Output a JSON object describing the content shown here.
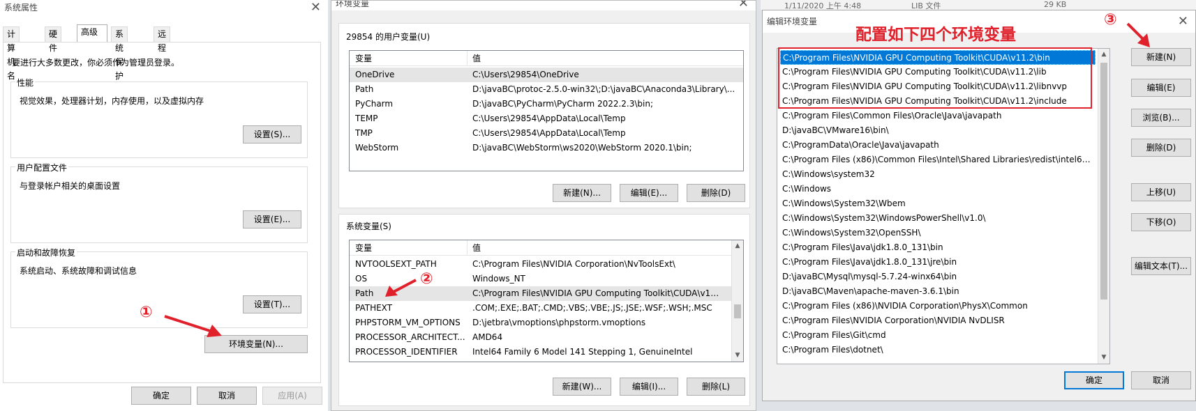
{
  "sys_props": {
    "title": "系统属性",
    "tabs": [
      "计算机名",
      "硬件",
      "高级",
      "系统保护",
      "远程"
    ],
    "admin_note": "要进行大多数更改，你必须作为管理员登录。",
    "performance": {
      "title": "性能",
      "desc": "视觉效果，处理器计划，内存使用，以及虚拟内存",
      "button": "设置(S)..."
    },
    "user_profile": {
      "title": "用户配置文件",
      "desc": "与登录帐户相关的桌面设置",
      "button": "设置(E)..."
    },
    "startup": {
      "title": "启动和故障恢复",
      "desc": "系统启动、系统故障和调试信息",
      "button": "设置(T)..."
    },
    "env_button": "环境变量(N)...",
    "ok": "确定",
    "cancel": "取消",
    "apply": "应用(A)"
  },
  "env_vars": {
    "title": "环境变量",
    "user_section": "29854 的用户变量(U)",
    "col_var": "变量",
    "col_val": "值",
    "user_rows": [
      {
        "name": "OneDrive",
        "value": "C:\\Users\\29854\\OneDrive"
      },
      {
        "name": "Path",
        "value": "D:\\javaBC\\protoc-2.5.0-win32\\;D:\\javaBC\\Anaconda3\\Library\\..."
      },
      {
        "name": "PyCharm",
        "value": "D:\\javaBC\\PyCharm\\PyCharm 2022.2.3\\bin;"
      },
      {
        "name": "TEMP",
        "value": "C:\\Users\\29854\\AppData\\Local\\Temp"
      },
      {
        "name": "TMP",
        "value": "C:\\Users\\29854\\AppData\\Local\\Temp"
      },
      {
        "name": "WebStorm",
        "value": "D:\\javaBC\\WebStorm\\ws2020\\WebStorm 2020.1\\bin;"
      }
    ],
    "user_buttons": [
      "新建(N)...",
      "编辑(E)...",
      "删除(D)"
    ],
    "sys_section": "系统变量(S)",
    "sys_rows": [
      {
        "name": "NVTOOLSEXT_PATH",
        "value": "C:\\Program Files\\NVIDIA Corporation\\NvToolsExt\\"
      },
      {
        "name": "OS",
        "value": "Windows_NT"
      },
      {
        "name": "Path",
        "value": "C:\\Program Files\\NVIDIA GPU Computing Toolkit\\CUDA\\v11...."
      },
      {
        "name": "PATHEXT",
        "value": ".COM;.EXE;.BAT;.CMD;.VBS;.VBE;.JS;.JSE;.WSF;.WSH;.MSC"
      },
      {
        "name": "PHPSTORM_VM_OPTIONS",
        "value": "D:\\jetbra\\vmoptions\\phpstorm.vmoptions"
      },
      {
        "name": "PROCESSOR_ARCHITECT...",
        "value": "AMD64"
      },
      {
        "name": "PROCESSOR_IDENTIFIER",
        "value": "Intel64 Family 6 Model 141 Stepping 1, GenuineIntel"
      }
    ],
    "sys_buttons": [
      "新建(W)...",
      "编辑(I)...",
      "删除(L)"
    ]
  },
  "edit_env": {
    "title": "编辑环境变量",
    "banner": "配置如下四个环境变量",
    "items": [
      "C:\\Program Files\\NVIDIA GPU Computing Toolkit\\CUDA\\v11.2\\bin",
      "C:\\Program Files\\NVIDIA GPU Computing Toolkit\\CUDA\\v11.2\\lib",
      "C:\\Program Files\\NVIDIA GPU Computing Toolkit\\CUDA\\v11.2\\libnvvp",
      "C:\\Program Files\\NVIDIA GPU Computing Toolkit\\CUDA\\v11.2\\include",
      "C:\\Program Files\\Common Files\\Oracle\\Java\\javapath",
      "D:\\javaBC\\VMware16\\bin\\",
      "C:\\ProgramData\\Oracle\\Java\\javapath",
      "C:\\Program Files (x86)\\Common Files\\Intel\\Shared Libraries\\redist\\intel64\\co...",
      "C:\\Windows\\system32",
      "C:\\Windows",
      "C:\\Windows\\System32\\Wbem",
      "C:\\Windows\\System32\\WindowsPowerShell\\v1.0\\",
      "C:\\Windows\\System32\\OpenSSH\\",
      "C:\\Program Files\\Java\\jdk1.8.0_131\\bin",
      "C:\\Program Files\\Java\\jdk1.8.0_131\\jre\\bin",
      "D:\\javaBC\\Mysql\\mysql-5.7.24-winx64\\bin",
      "D:\\javaBC\\Maven\\apache-maven-3.6.1\\bin",
      "C:\\Program Files (x86)\\NVIDIA Corporation\\PhysX\\Common",
      "C:\\Program Files\\NVIDIA Corporation\\NVIDIA NvDLISR",
      "C:\\Program Files\\Git\\cmd",
      "C:\\Program Files\\dotnet\\"
    ],
    "side_buttons": {
      "new": "新建(N)",
      "edit": "编辑(E)",
      "browse": "浏览(B)...",
      "delete": "删除(D)",
      "up": "上移(U)",
      "down": "下移(O)",
      "edit_text": "编辑文本(T)..."
    },
    "ok": "确定",
    "cancel": "取消"
  },
  "background": {
    "file_date": "1/11/2020 上午 4:48",
    "file_type": "LIB 文件",
    "file_size": "29 KB"
  },
  "annotations": {
    "step1": "①",
    "step2": "②",
    "step3": "③"
  },
  "colors": {
    "annotation": "#e0202a",
    "selection": "#0078d7"
  }
}
